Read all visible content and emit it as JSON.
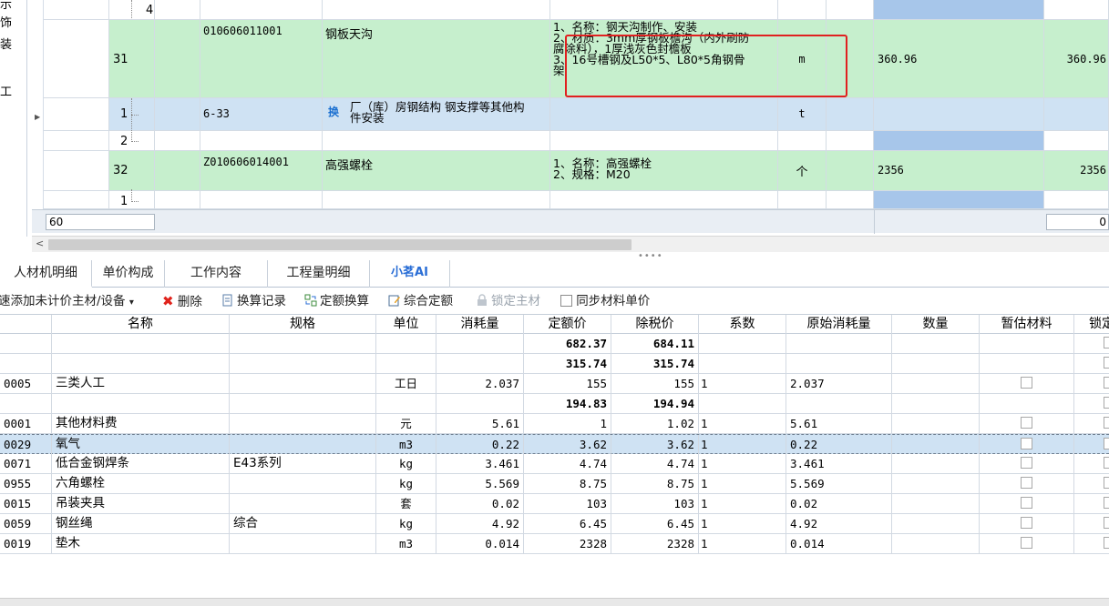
{
  "left_strip": [
    "示",
    "饰",
    "装",
    "工"
  ],
  "upper_rows": [
    {
      "seq": "4",
      "code": "",
      "name": "",
      "desc": "",
      "unit": "",
      "qty": "",
      "qty2": ""
    },
    {
      "seq": "31",
      "code": "010606011001",
      "name": "钢板天沟",
      "desc_lines": [
        "1、名称：钢天沟制作、安装",
        "2、材质：3mm厚钢板檐沟（内外刷防",
        "腐涂料），1厚浅灰色封檐板",
        "3、16号槽钢及L50*5、L80*5角钢骨",
        "架"
      ],
      "unit": "m",
      "qty": "360.96",
      "qty2": "360.96"
    },
    {
      "seq": "1",
      "code": "6-33",
      "badge": "换",
      "name_lines": [
        "厂（库）房钢结构 钢支撑等其他构",
        "件安装"
      ],
      "unit": "t"
    },
    {
      "seq": "2"
    },
    {
      "seq": "32",
      "code": "Z010606014001",
      "name": "高强螺栓",
      "desc_lines": [
        "1、名称：高强螺栓",
        "2、规格：M20"
      ],
      "unit": "个",
      "qty": "2356",
      "qty2": "2356"
    },
    {
      "seq": "1"
    }
  ],
  "input_row": {
    "left_value": "60",
    "right_value": "0"
  },
  "tabs": [
    {
      "label": "人材机明细",
      "active": true
    },
    {
      "label": "单价构成"
    },
    {
      "label": "工作内容"
    },
    {
      "label": "工程量明细"
    },
    {
      "label": "小茗AI",
      "ai": true
    }
  ],
  "toolbar": {
    "quick_add": "速添加未计价主材/设备",
    "delete": "删除",
    "convert_record": "换算记录",
    "quota_convert": "定额换算",
    "comprehensive_quota": "综合定额",
    "lock_material": "锁定主材",
    "sync_price": "同步材料单价"
  },
  "columns": [
    "名称",
    "规格",
    "单位",
    "消耗量",
    "定额价",
    "除税价",
    "系数",
    "原始消耗量",
    "数量",
    "暂估材料",
    "锁定"
  ],
  "rows": [
    {
      "code": "",
      "name": "",
      "spec": "",
      "unit": "",
      "consume": "",
      "quota": "682.37",
      "notax": "684.11",
      "coef": "",
      "orig": "",
      "bold": true,
      "checkbox": false
    },
    {
      "code": "",
      "name": "",
      "spec": "",
      "unit": "",
      "consume": "",
      "quota": "315.74",
      "notax": "315.74",
      "coef": "",
      "orig": "",
      "bold": true,
      "checkbox": false
    },
    {
      "code": "0005",
      "name": "三类人工",
      "spec": "",
      "unit": "工日",
      "consume": "2.037",
      "quota": "155",
      "notax": "155",
      "coef": "1",
      "orig": "2.037",
      "checkbox": true
    },
    {
      "code": "",
      "name": "",
      "spec": "",
      "unit": "",
      "consume": "",
      "quota": "194.83",
      "notax": "194.94",
      "coef": "",
      "orig": "",
      "bold": true,
      "checkbox": false
    },
    {
      "code": "0001",
      "name": "其他材料费",
      "spec": "",
      "unit": "元",
      "consume": "5.61",
      "quota": "1",
      "notax": "1.02",
      "coef": "1",
      "orig": "5.61",
      "checkbox": true
    },
    {
      "code": "0029",
      "name": "氧气",
      "spec": "",
      "unit": "m3",
      "consume": "0.22",
      "quota": "3.62",
      "notax": "3.62",
      "coef": "1",
      "orig": "0.22",
      "checkbox": true,
      "selected": true
    },
    {
      "code": "0071",
      "name": "低合金钢焊条",
      "spec": "E43系列",
      "unit": "kg",
      "consume": "3.461",
      "quota": "4.74",
      "notax": "4.74",
      "coef": "1",
      "orig": "3.461",
      "checkbox": true
    },
    {
      "code": "0955",
      "name": "六角螺栓",
      "spec": "",
      "unit": "kg",
      "consume": "5.569",
      "quota": "8.75",
      "notax": "8.75",
      "coef": "1",
      "orig": "5.569",
      "checkbox": true
    },
    {
      "code": "0015",
      "name": "吊装夹具",
      "spec": "",
      "unit": "套",
      "consume": "0.02",
      "quota": "103",
      "notax": "103",
      "coef": "1",
      "orig": "0.02",
      "checkbox": true
    },
    {
      "code": "0059",
      "name": "钢丝绳",
      "spec": "综合",
      "unit": "kg",
      "consume": "4.92",
      "quota": "6.45",
      "notax": "6.45",
      "coef": "1",
      "orig": "4.92",
      "checkbox": true
    },
    {
      "code": "0019",
      "name": "垫木",
      "spec": "",
      "unit": "m3",
      "consume": "0.014",
      "quota": "2328",
      "notax": "2328",
      "coef": "1",
      "orig": "0.014",
      "checkbox": true
    }
  ],
  "colors": {
    "green_row": "#c6efcd",
    "blue_row": "#cfe2f3",
    "highlight_col": "#a7c6ea",
    "red_box": "#e02020",
    "ai_tab": "#2a6ed6"
  }
}
